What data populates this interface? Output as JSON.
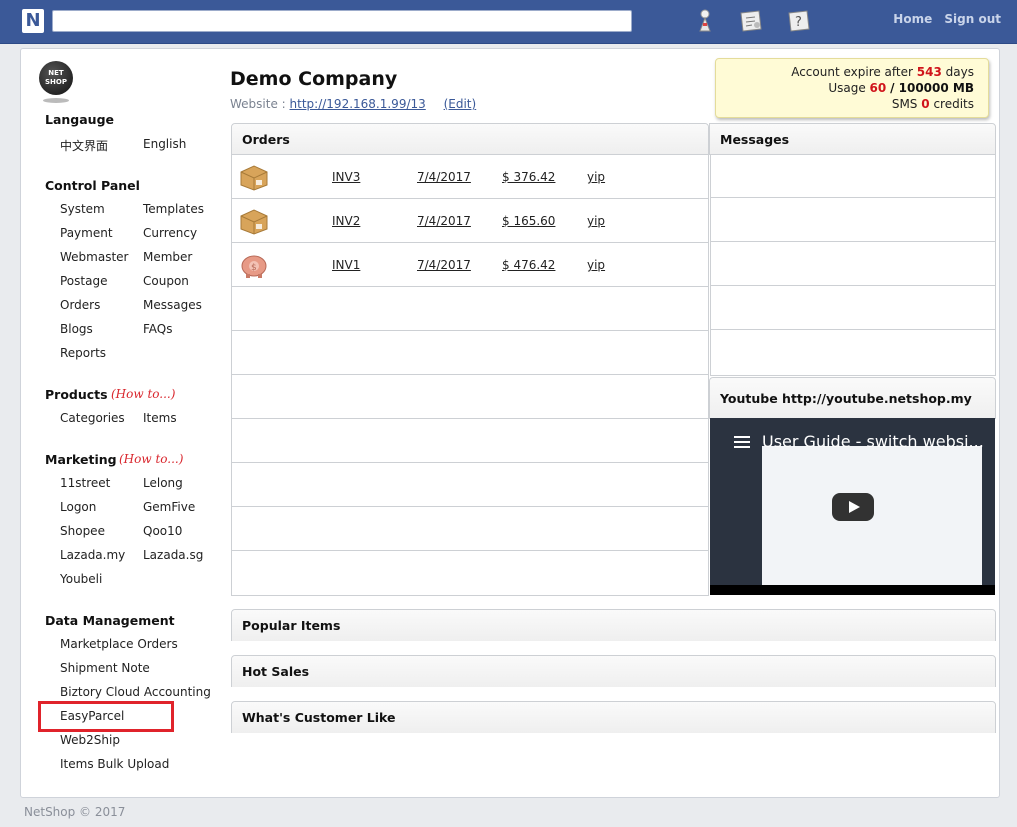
{
  "topbar": {
    "logo": "N",
    "search_value": "",
    "icons": [
      "user-icon",
      "settings-icon",
      "help-icon"
    ],
    "home_label": "Home",
    "signout_label": "Sign out"
  },
  "sidebar": {
    "logo_text": "NET SHOP",
    "language": {
      "title": "Langauge",
      "items": [
        "中文界面",
        "English"
      ]
    },
    "control_panel": {
      "title": "Control Panel",
      "items": [
        "System",
        "Templates",
        "Payment",
        "Currency",
        "Webmaster",
        "Member",
        "Postage",
        "Coupon",
        "Orders",
        "Messages",
        "Blogs",
        "FAQs",
        "Reports"
      ]
    },
    "products": {
      "title": "Products",
      "howto": "(How to...)",
      "items": [
        "Categories",
        "Items"
      ]
    },
    "marketing": {
      "title": "Marketing",
      "howto": "(How to...)",
      "items": [
        "11street",
        "Lelong",
        "Logon",
        "GemFive",
        "Shopee",
        "Qoo10",
        "Lazada.my",
        "Lazada.sg",
        "Youbeli"
      ]
    },
    "data_management": {
      "title": "Data Management",
      "items": [
        "Marketplace Orders",
        "Shipment Note",
        "Biztory Cloud Accounting",
        "EasyParcel",
        "Web2Ship",
        "Items Bulk Upload"
      ]
    }
  },
  "company": {
    "name": "Demo Company",
    "website_label": "Website :",
    "website_url": "http://192.168.1.99/13",
    "edit_label": "(Edit)"
  },
  "account": {
    "expire_prefix": "Account expire after",
    "expire_days": "543",
    "expire_suffix": "days",
    "usage_prefix": "Usage",
    "usage_used": "60",
    "usage_total": "/ 100000 MB",
    "sms_prefix": "SMS",
    "sms_count": "0",
    "sms_suffix": "credits"
  },
  "orders": {
    "title": "Orders",
    "rows": [
      {
        "icon": "parcel-icon",
        "invoice": "INV3",
        "date": "7/4/2017",
        "amount": "$ 376.42",
        "customer": "yip"
      },
      {
        "icon": "parcel-icon",
        "invoice": "INV2",
        "date": "7/4/2017",
        "amount": "$ 165.60",
        "customer": "yip"
      },
      {
        "icon": "piggy-bank-icon",
        "invoice": "INV1",
        "date": "7/4/2017",
        "amount": "$ 476.42",
        "customer": "yip"
      }
    ]
  },
  "messages": {
    "title": "Messages"
  },
  "youtube": {
    "title": "Youtube  http://youtube.netshop.my",
    "video_title": "User Guide - switch websi..."
  },
  "sections": {
    "popular": "Popular Items",
    "hot_sales": "Hot Sales",
    "customer_like": "What's Customer Like"
  },
  "footer": "NetShop © 2017",
  "colors": {
    "topbar": "#3b5998",
    "accent_red": "#d0141b",
    "highlight": "#e0232b"
  }
}
